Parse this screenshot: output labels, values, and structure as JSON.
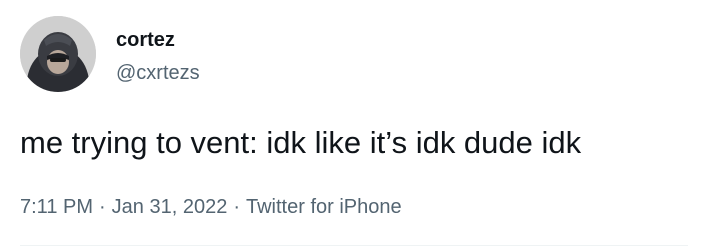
{
  "tweet": {
    "author": {
      "display_name": "cortez",
      "handle": "@cxrtezs"
    },
    "text": "me trying to vent: idk like it’s idk dude idk",
    "time": "7:11 PM",
    "date": "Jan 31, 2022",
    "source": "Twitter for iPhone",
    "separator": "·"
  }
}
